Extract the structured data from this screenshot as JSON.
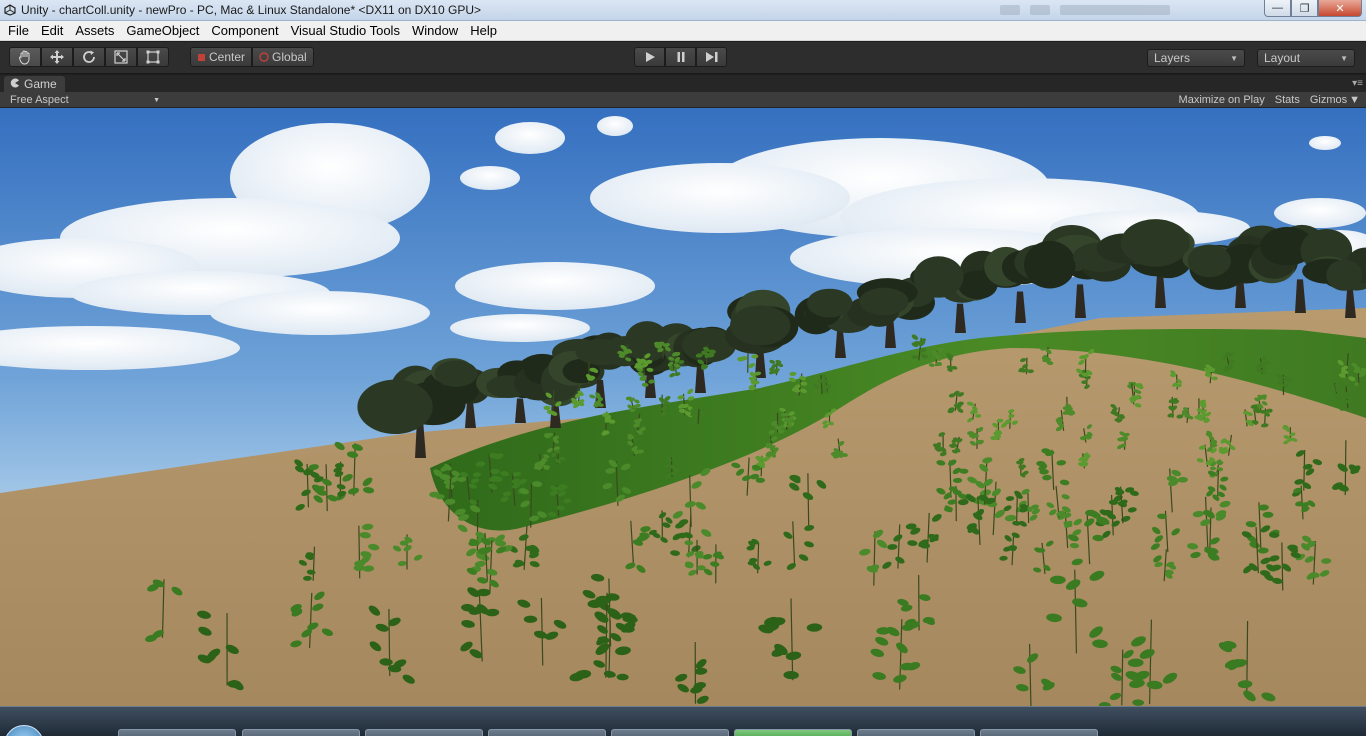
{
  "window": {
    "title": "Unity - chartColl.unity - newPro - PC, Mac & Linux Standalone* <DX11 on DX10 GPU>",
    "app_icon": "unity-logo-icon",
    "controls": [
      "minimize-icon",
      "restore-icon",
      "close-icon"
    ]
  },
  "menu": {
    "items": [
      "File",
      "Edit",
      "Assets",
      "GameObject",
      "Component",
      "Visual Studio Tools",
      "Window",
      "Help"
    ]
  },
  "toolbar": {
    "transform_tools": [
      {
        "name": "hand-tool",
        "icon": "hand-icon"
      },
      {
        "name": "move-tool",
        "icon": "move-arrows-icon"
      },
      {
        "name": "rotate-tool",
        "icon": "rotate-icon"
      },
      {
        "name": "scale-tool",
        "icon": "scale-icon"
      },
      {
        "name": "rect-tool",
        "icon": "rect-icon"
      }
    ],
    "pivot_mode_label": "Center",
    "pivot_rotation_label": "Global",
    "play_controls": [
      "play-icon",
      "pause-icon",
      "step-icon"
    ],
    "layers_label": "Layers",
    "layout_label": "Layout"
  },
  "game_panel": {
    "tab_label": "Game",
    "aspect_label": "Free Aspect",
    "maximize_label": "Maximize on Play",
    "stats_label": "Stats",
    "gizmos_label": "Gizmos"
  },
  "colors": {
    "sky_top": "#3a78c8",
    "sky_horizon": "#bcd8ee",
    "ground": "#b0936a",
    "grass": "#3f7a22",
    "editor_dark": "#2d2d2d"
  },
  "taskbar": {
    "start_icon": "windows-start-icon"
  }
}
